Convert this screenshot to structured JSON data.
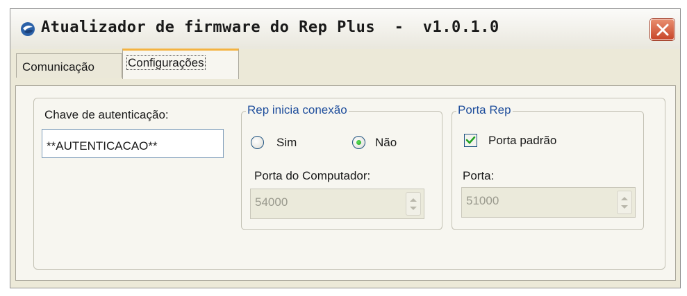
{
  "window": {
    "title": "Atualizador de firmware do Rep Plus  -  v1.0.1.0",
    "icon": "app-logo-icon",
    "close_icon": "close-icon"
  },
  "tabs": [
    {
      "label": "Comunicação",
      "active": false
    },
    {
      "label": "Configurações",
      "active": true
    }
  ],
  "auth": {
    "label": "Chave de autenticação:",
    "value": "**AUTENTICACAO**"
  },
  "rep_connection": {
    "legend": "Rep inicia conexão",
    "options": [
      {
        "label": "Sim",
        "selected": false
      },
      {
        "label": "Não",
        "selected": true
      }
    ],
    "port_label": "Porta do Computador:",
    "port_value": "54000",
    "port_enabled": false
  },
  "rep_port": {
    "legend": "Porta Rep",
    "checkbox_label": "Porta padrão",
    "checkbox_checked": true,
    "port_label": "Porta:",
    "port_value": "51000",
    "port_enabled": false
  },
  "colors": {
    "accent_tab": "#f4b340",
    "legend_text": "#1f4e9c",
    "close_button": "#d35a3c",
    "check_mark": "#21a121"
  }
}
